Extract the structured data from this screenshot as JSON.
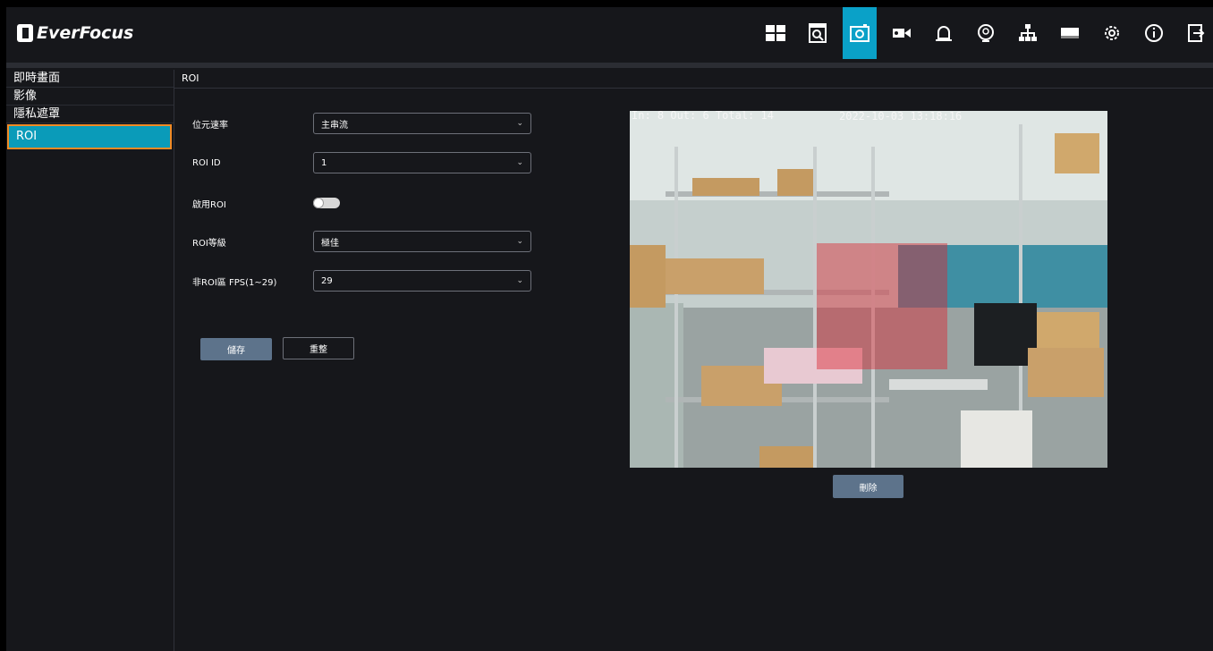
{
  "brand": {
    "name": "EverFocus"
  },
  "nav": {
    "icons": [
      "layout-grid-icon",
      "playback-icon",
      "camera-icon",
      "video-icon",
      "alarm-bell-icon",
      "ai-analytics-icon",
      "network-icon",
      "storage-icon",
      "settings-gear-icon",
      "info-icon",
      "logout-icon"
    ],
    "active_index": 2,
    "accent_color": "#0aa1c8"
  },
  "sidebar": {
    "items": [
      {
        "label": "即時畫面"
      },
      {
        "label": "影像"
      },
      {
        "label": "隱私遮罩"
      },
      {
        "label": "ROI"
      }
    ],
    "active_index": 3,
    "highlight_color": "#f08a25"
  },
  "main": {
    "header": "ROI",
    "form": {
      "bitrate": {
        "label": "位元速率",
        "value": "主串流"
      },
      "roi_id": {
        "label": "ROI ID",
        "value": "1"
      },
      "enable": {
        "label": "啟用ROI",
        "enabled": true
      },
      "level": {
        "label": "ROI等級",
        "value": "極佳"
      },
      "fps": {
        "label": "非ROI區 FPS(1~29)",
        "value": "29"
      }
    },
    "buttons": {
      "save": "儲存",
      "reset": "重整",
      "delete": "刪除"
    },
    "preview": {
      "osd_counts": "In: 8 Out: 6 Total: 14",
      "osd_timestamp": "2022-10-03 13:18:16"
    }
  }
}
